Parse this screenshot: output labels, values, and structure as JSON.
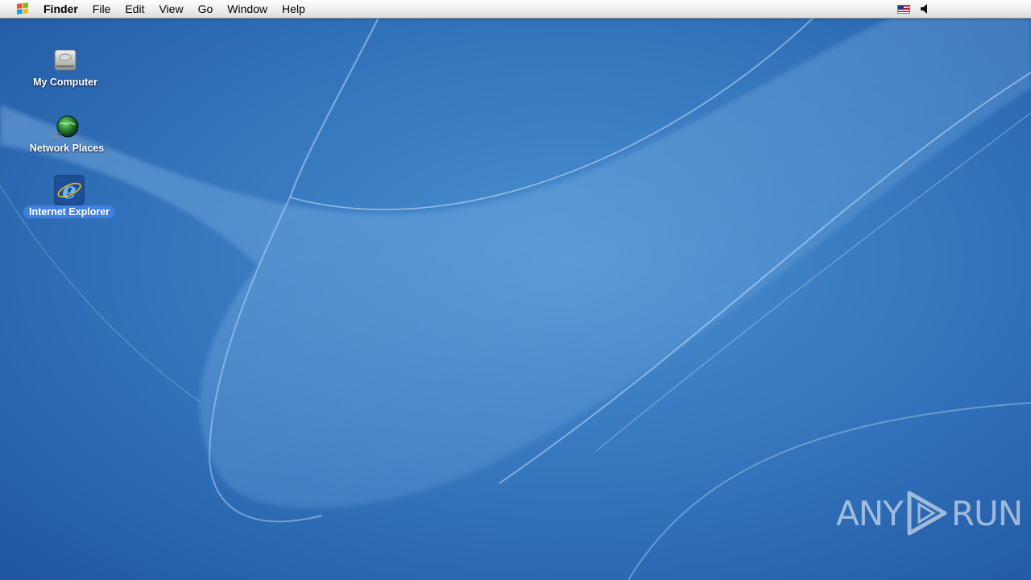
{
  "menubar": {
    "app_name": "Finder",
    "items": [
      "File",
      "Edit",
      "View",
      "Go",
      "Window",
      "Help"
    ],
    "status_icons": [
      "us-flag-icon",
      "speaker-icon"
    ]
  },
  "desktop": {
    "icons": [
      {
        "label": "My Computer",
        "icon": "hard-drive-icon",
        "selected": false
      },
      {
        "label": "Network Places",
        "icon": "network-globe-icon",
        "selected": false
      },
      {
        "label": "Internet Explorer",
        "icon": "internet-explorer-icon",
        "selected": true
      }
    ]
  },
  "watermark": {
    "left": "ANY",
    "right": "RUN"
  },
  "colors": {
    "wallpaper_base": "#2f6db4",
    "selection": "#3f7fe0"
  }
}
